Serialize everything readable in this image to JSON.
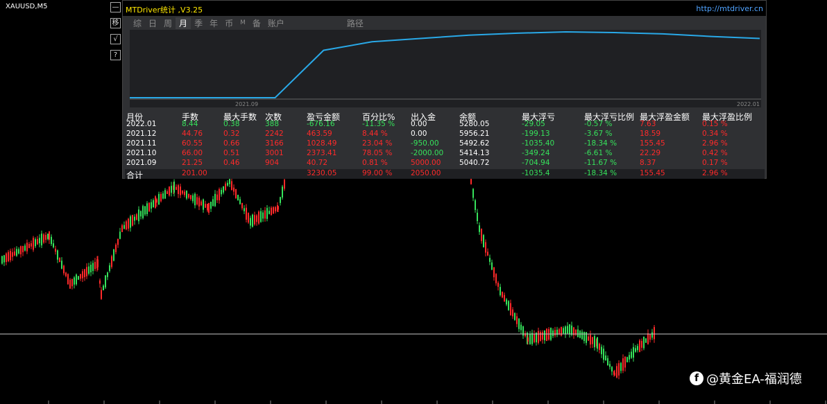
{
  "chart": {
    "symbol": "XAUUSD,M5",
    "bull_color": "#36e25b",
    "bear_color": "#ff2a2a",
    "watermark": "@黄金EA-福润德"
  },
  "side_buttons": [
    "—",
    "移",
    "√",
    "?"
  ],
  "panel": {
    "title": "MTDriver统计 ,V3.25",
    "url": "http://mtdriver.cn",
    "tabs": [
      {
        "label": "综",
        "active": false
      },
      {
        "label": "日",
        "active": false
      },
      {
        "label": "周",
        "active": false
      },
      {
        "label": "月",
        "active": true
      },
      {
        "label": "季",
        "active": false
      },
      {
        "label": "年",
        "active": false
      },
      {
        "label": "币",
        "active": false
      },
      {
        "label": "M",
        "active": false
      },
      {
        "label": "备",
        "active": false
      },
      {
        "label": "账户",
        "active": false
      },
      {
        "label": "路径",
        "active": false
      }
    ],
    "equity_chart": {
      "x_start_label": "2021.09",
      "x_end_label": "2022.01",
      "line_color": "#29a9e8",
      "points": [
        0.0,
        0.0,
        0.0,
        0.0,
        0.72,
        0.85,
        0.9,
        0.95,
        0.98,
        1.0,
        0.99,
        0.97,
        0.93,
        0.9
      ]
    },
    "table": {
      "headers": [
        "月份",
        "手数",
        "最大手数",
        "次数",
        "盈亏金额",
        "百分比%",
        "出入金",
        "余额",
        "最大浮亏",
        "最大浮亏比例",
        "最大浮盈金额",
        "最大浮盈比例"
      ],
      "rows": [
        {
          "month": "2022.01",
          "lots": "8.44",
          "max_lots": "0.38",
          "count": "388",
          "pnl": "-676.16",
          "pct": "-11.35 %",
          "flow": "0.00",
          "balance": "5280.05",
          "max_float_loss": "-29.05",
          "max_float_loss_pct": "-0.57 %",
          "max_float_profit": "7.63",
          "max_float_profit_pct": "0.15 %",
          "tone": "g",
          "flow_tone": "w"
        },
        {
          "month": "2021.12",
          "lots": "44.76",
          "max_lots": "0.32",
          "count": "2242",
          "pnl": "463.59",
          "pct": "8.44 %",
          "flow": "0.00",
          "balance": "5956.21",
          "max_float_loss": "-199.13",
          "max_float_loss_pct": "-3.67 %",
          "max_float_profit": "18.59",
          "max_float_profit_pct": "0.34 %",
          "tone": "r",
          "flow_tone": "w"
        },
        {
          "month": "2021.11",
          "lots": "60.55",
          "max_lots": "0.66",
          "count": "3166",
          "pnl": "1028.49",
          "pct": "23.04 %",
          "flow": "-950.00",
          "balance": "5492.62",
          "max_float_loss": "-1035.40",
          "max_float_loss_pct": "-18.34 %",
          "max_float_profit": "155.45",
          "max_float_profit_pct": "2.96 %",
          "tone": "r",
          "flow_tone": "g"
        },
        {
          "month": "2021.10",
          "lots": "66.00",
          "max_lots": "0.51",
          "count": "3001",
          "pnl": "2373.41",
          "pct": "78.05 %",
          "flow": "-2000.00",
          "balance": "5414.13",
          "max_float_loss": "-349.24",
          "max_float_loss_pct": "-6.61 %",
          "max_float_profit": "22.29",
          "max_float_profit_pct": "0.42 %",
          "tone": "r",
          "flow_tone": "g"
        },
        {
          "month": "2021.09",
          "lots": "21.25",
          "max_lots": "0.46",
          "count": "904",
          "pnl": "40.72",
          "pct": "0.81 %",
          "flow": "5000.00",
          "balance": "5040.72",
          "max_float_loss": "-704.94",
          "max_float_loss_pct": "-11.67 %",
          "max_float_profit": "8.37",
          "max_float_profit_pct": "0.17 %",
          "tone": "r",
          "flow_tone": "r"
        }
      ],
      "total": {
        "label": "合计",
        "lots": "201.00",
        "pnl": "3230.05",
        "pct": "99.00 %",
        "flow": "2050.00",
        "max_float_loss": "-1035.4",
        "max_float_loss_pct": "-18.34 %",
        "max_float_profit": "155.45",
        "max_float_profit_pct": "2.96 %"
      }
    }
  }
}
